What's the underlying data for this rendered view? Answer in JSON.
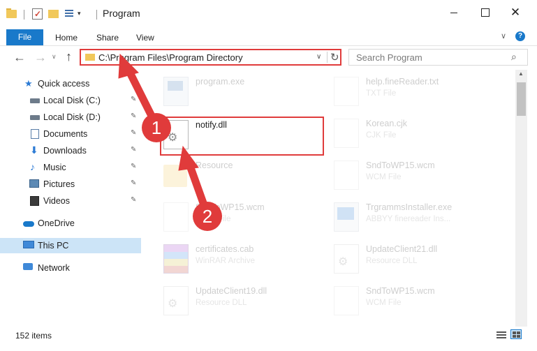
{
  "window": {
    "title": "Program",
    "minimize_symbol": "",
    "close_symbol": "✕"
  },
  "ribbon": {
    "tabs": [
      "File",
      "Home",
      "Share",
      "View"
    ],
    "expand_glyph": "∨",
    "help_glyph": "?"
  },
  "navbar": {
    "back_glyph": "←",
    "forward_glyph": "→",
    "recent_glyph": "∨",
    "up_glyph": "↑",
    "address": "C:\\Program Files\\Program Directory",
    "address_dropdown_glyph": "∨",
    "refresh_glyph": "↻",
    "search_placeholder": "Search Program",
    "search_glyph": "⌕"
  },
  "sidebar": {
    "items": [
      {
        "label": "Quick access",
        "icon": "star-icon",
        "pinned": false
      },
      {
        "label": "Local Disk (C:)",
        "icon": "drive-icon",
        "pinned": true
      },
      {
        "label": "Local Disk (D:)",
        "icon": "drive-icon",
        "pinned": true
      },
      {
        "label": "Documents",
        "icon": "documents-icon",
        "pinned": true
      },
      {
        "label": "Downloads",
        "icon": "download-icon",
        "pinned": true
      },
      {
        "label": "Music",
        "icon": "music-icon",
        "pinned": true
      },
      {
        "label": "Pictures",
        "icon": "pictures-icon",
        "pinned": true
      },
      {
        "label": "Videos",
        "icon": "videos-icon",
        "pinned": true
      },
      {
        "label": "OneDrive",
        "icon": "cloud-icon",
        "pinned": false
      },
      {
        "label": "This PC",
        "icon": "computer-icon",
        "pinned": false,
        "selected": true
      },
      {
        "label": "Network",
        "icon": "network-icon",
        "pinned": false
      }
    ],
    "pin_glyph": "📌"
  },
  "files": {
    "left": [
      {
        "name": "program.exe",
        "type": ""
      },
      {
        "name": "notify.dll",
        "type": ""
      },
      {
        "name": "Resource",
        "type": ""
      },
      {
        "name": "SndToWP15.wcm",
        "type": "WCM File"
      },
      {
        "name": "certificates.cab",
        "type": "WinRAR Archive"
      },
      {
        "name": "UpdateClient19.dll",
        "type": "Resource DLL"
      }
    ],
    "right": [
      {
        "name": "help.fineReader.txt",
        "type": "TXT File"
      },
      {
        "name": "Korean.cjk",
        "type": "CJK File"
      },
      {
        "name": "SndToWP15.wcm",
        "type": "WCM File"
      },
      {
        "name": "TrgrammsInstaller.exe",
        "type": "ABBYY finereader Ins..."
      },
      {
        "name": "UpdateClient21.dll",
        "type": "Resource DLL"
      },
      {
        "name": "SndToWP15.wcm",
        "type": "WCM File"
      }
    ]
  },
  "status": {
    "item_count": "152 items"
  },
  "annotations": {
    "step1": "1",
    "step2": "2",
    "color": "#e03b3b"
  },
  "colors": {
    "accent": "#1979ca",
    "selection": "#cce4f7",
    "highlight_red": "#e03b3b"
  }
}
